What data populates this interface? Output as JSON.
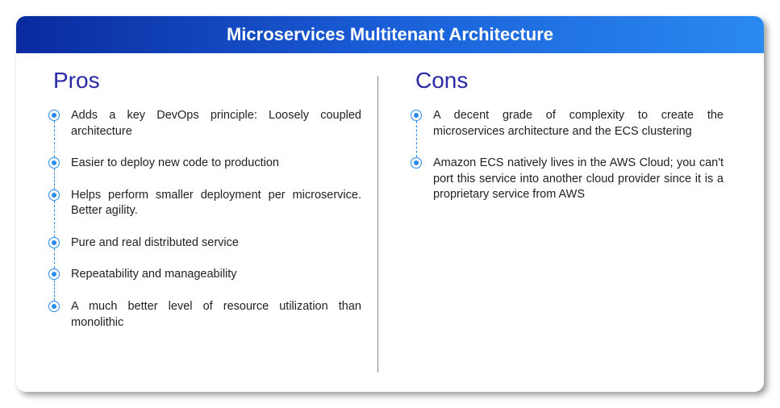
{
  "header": {
    "title": "Microservices Multitenant Architecture"
  },
  "pros": {
    "title": "Pros",
    "items": [
      "Adds a key DevOps principle: Loosely coupled architecture",
      "Easier to deploy new code to production",
      "Helps perform smaller deployment per microservice. Better agility.",
      "Pure and real distributed service",
      "Repeatability and manageability",
      "A much better level of resource utilization than monolithic"
    ]
  },
  "cons": {
    "title": "Cons",
    "items": [
      "A decent grade of complexity to create the microservices architecture and the ECS clustering",
      "Amazon ECS natively lives in the AWS Cloud; you can't port this service into another cloud provider since it is a proprietary service from AWS"
    ]
  }
}
